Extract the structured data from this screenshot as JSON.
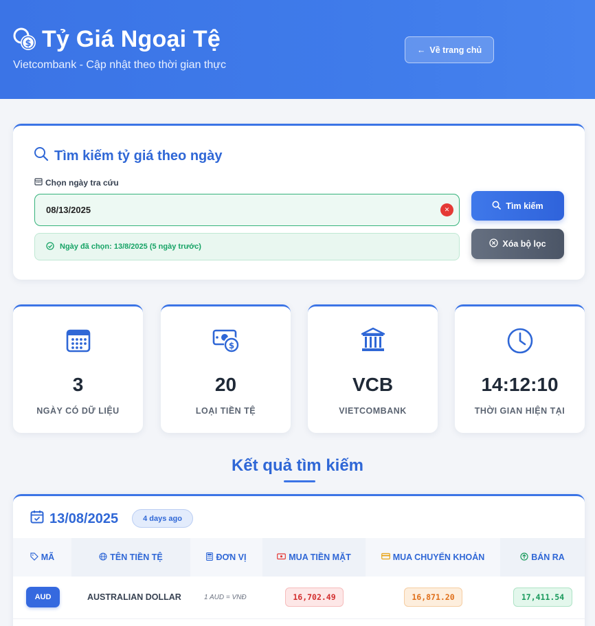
{
  "header": {
    "title": "Tỷ Giá Ngoại Tệ",
    "subtitle": "Vietcombank - Cập nhật theo thời gian thực",
    "home_button": "Về trang chủ",
    "icon": "coins-icon"
  },
  "search": {
    "title": "Tìm kiếm tỷ giá theo ngày",
    "date_label": "Chọn ngày tra cứu",
    "date_value": "08/13/2025",
    "selected_note": "Ngày đã chọn: 13/8/2025 (5 ngày trước)",
    "search_button": "Tìm kiếm",
    "clear_button": "Xóa bộ lọc"
  },
  "stats": [
    {
      "value": "3",
      "label": "NGÀY CÓ DỮ LIỆU",
      "icon": "calendar-icon"
    },
    {
      "value": "20",
      "label": "LOẠI TIỀN TỆ",
      "icon": "money-icon"
    },
    {
      "value": "VCB",
      "label": "VIETCOMBANK",
      "icon": "bank-icon"
    },
    {
      "value": "14:12:10",
      "label": "THỜI GIAN HIỆN TẠI",
      "icon": "clock-icon"
    }
  ],
  "results": {
    "title": "Kết quả tìm kiếm",
    "date": "13/08/2025",
    "badge": "4 days ago",
    "columns": [
      "MÃ",
      "TÊN TIỀN TỆ",
      "ĐƠN VỊ",
      "MUA TIỀN MẶT",
      "MUA CHUYỂN KHOẢN",
      "BÁN RA"
    ],
    "rows": [
      {
        "code": "AUD",
        "name": "AUSTRALIAN DOLLAR",
        "unit": "1 AUD = VNĐ",
        "cash_buy": "16,702.49",
        "transfer_buy": "16,871.20",
        "sell": "17,411.54"
      }
    ]
  },
  "colors": {
    "primary": "#3b74e6",
    "cash": "#d32f2f",
    "transfer": "#e0701b",
    "sell": "#1a9a5c"
  }
}
